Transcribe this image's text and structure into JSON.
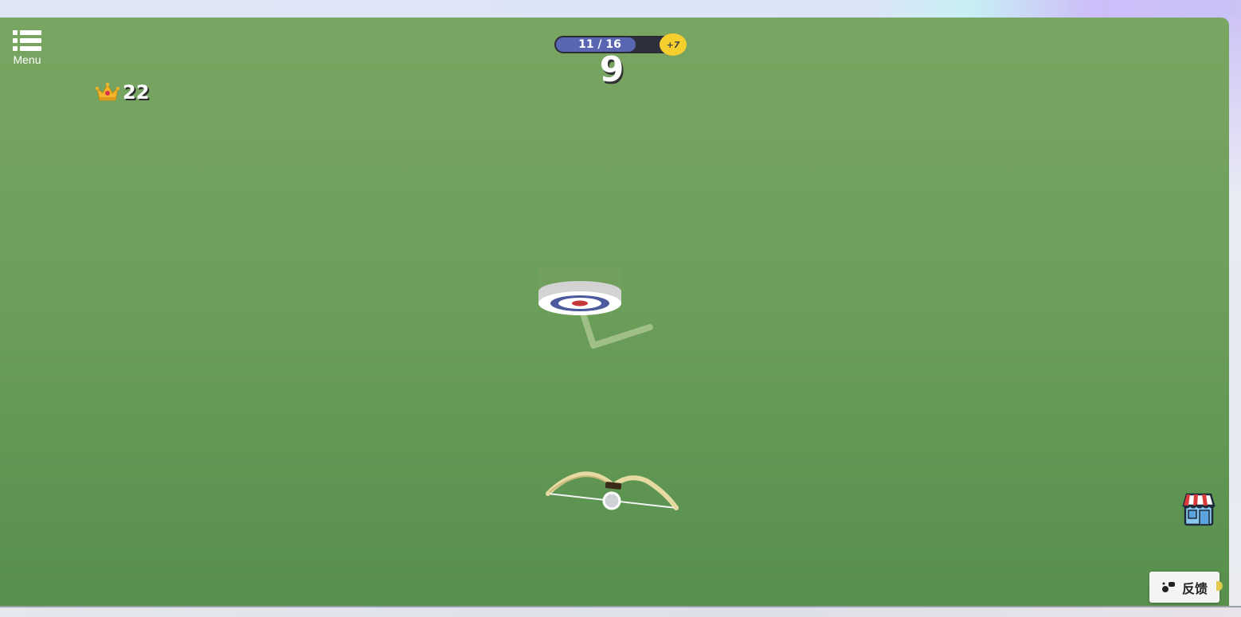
{
  "menu": {
    "label": "Menu",
    "icon": "list-icon"
  },
  "best_score": {
    "icon": "crown-icon",
    "value": "22"
  },
  "progress": {
    "text": "11 / 16",
    "current": 11,
    "total": 16
  },
  "bonus": {
    "text": "+7",
    "icon": "coin-icon"
  },
  "score": {
    "value": "9"
  },
  "shop": {
    "icon": "shop-icon"
  },
  "feedback": {
    "label": "反馈",
    "icon": "feedback-icon"
  },
  "colors": {
    "background_top": "#79a662",
    "background_bottom": "#578f4d",
    "progress_fill": "#5a66b2",
    "coin": "#f5cf2e",
    "target_ring": "#4a5a9c",
    "target_center": "#c63a3a"
  }
}
